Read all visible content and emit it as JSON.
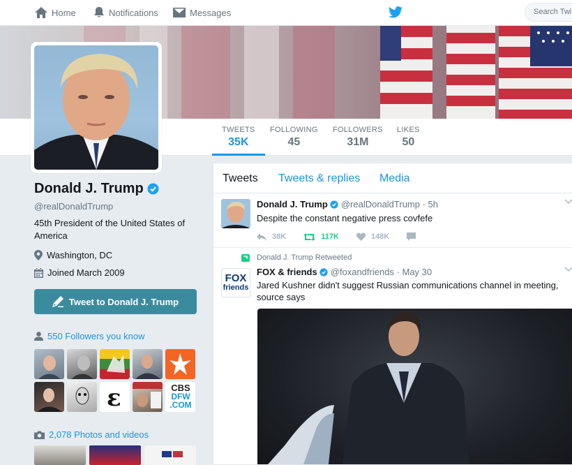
{
  "nav": {
    "home": "Home",
    "notifications": "Notifications",
    "messages": "Messages",
    "search_placeholder": "Search Twi"
  },
  "stats": [
    {
      "label": "TWEETS",
      "value": "35K"
    },
    {
      "label": "FOLLOWING",
      "value": "45"
    },
    {
      "label": "FOLLOWERS",
      "value": "31M"
    },
    {
      "label": "LIKES",
      "value": "50"
    }
  ],
  "profile": {
    "name": "Donald J. Trump",
    "handle": "@realDonaldTrump",
    "bio": "45th President of the United States of America",
    "location": "Washington, DC",
    "joined": "Joined March 2009",
    "tweet_to_label": "Tweet to Donald J. Trump",
    "followers_you_know": "550 Followers you know",
    "photos_videos": "2,078 Photos and videos"
  },
  "followers_you_know_tiles": {
    "cbs_line1": "CBS",
    "cbs_line2": "DFW",
    "cbs_line3": ".COM",
    "esquire_mark": "ε"
  },
  "timeline": {
    "tabs": [
      "Tweets",
      "Tweets & replies",
      "Media"
    ],
    "tweets": [
      {
        "name": "Donald J. Trump",
        "handle": "@realDonaldTrump · 5h",
        "text": "Despite the constant negative press covfefe",
        "replies": "38K",
        "retweets": "117K",
        "likes": "148K"
      },
      {
        "context": "Donald J. Trump Retweeted",
        "name": "FOX & friends",
        "handle": "@foxandfriends · May 30",
        "text": "Jared Kushner didn't suggest Russian communications channel in meeting, source says",
        "logo_line1": "FOX",
        "logo_line2": "friends"
      }
    ]
  },
  "colors": {
    "accent": "#1b95e0",
    "button": "#3b8b9e",
    "retweet": "#19cf86",
    "verified": "#1da1f2"
  }
}
